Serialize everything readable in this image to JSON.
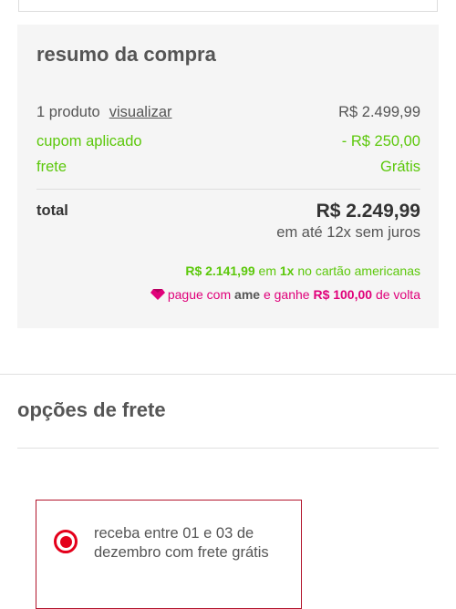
{
  "summary": {
    "title": "resumo da compra",
    "product_count": "1 produto",
    "view_link": "visualizar",
    "product_price": "R$ 2.499,99",
    "coupon_label": "cupom aplicado",
    "coupon_value": "- R$ 250,00",
    "shipping_label": "frete",
    "shipping_value": "Grátis",
    "total_label": "total",
    "total_value": "R$ 2.249,99",
    "installments": "em até 12x sem juros",
    "card_offer": {
      "price": "R$ 2.141,99",
      "em": "em",
      "times": "1x",
      "text": "no cartão americanas"
    },
    "ame_offer": {
      "prefix": "pague com",
      "brand": "ame",
      "mid": "e ganhe",
      "amount": "R$ 100,00",
      "suffix": "de volta"
    }
  },
  "shipping_options": {
    "title": "opções de frete",
    "options": [
      {
        "label": "receba entre 01 e 03 de dezembro com frete grátis",
        "selected": true
      }
    ]
  },
  "colors": {
    "green": "#5cc80b",
    "ame_pink": "#e0007a",
    "radio_red": "#e4001b",
    "border_red": "#b2142c"
  },
  "icons": {
    "ame": "gem-icon",
    "radio": "radio-selected-icon"
  }
}
